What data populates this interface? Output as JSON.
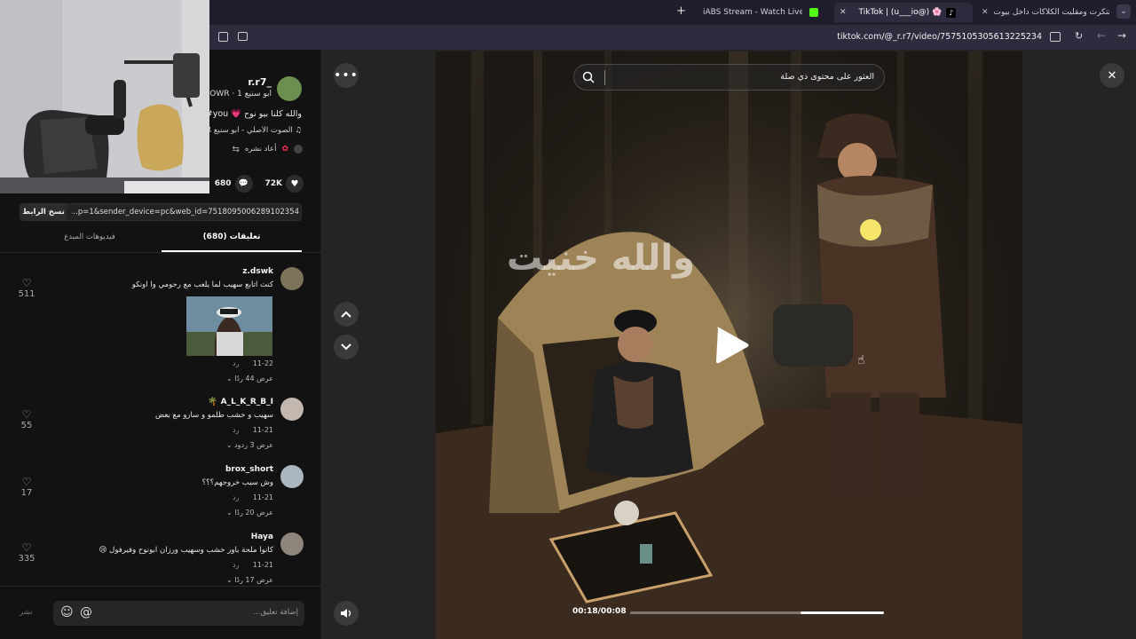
{
  "browser": {
    "tabs": [
      {
        "title": "تتكرت ومقلبت الكلاكات داخل بيوت",
        "active": false
      },
      {
        "title": "TikTok | (u___io@) 🌸",
        "active": true
      },
      {
        "title": "iABS Stream - Watch Live on Ki",
        "active": false
      }
    ],
    "new_tab": "+",
    "url": "tiktok.com/@_r.r7/video/7575105305613225234"
  },
  "post": {
    "username": "_r.r7",
    "subtitle": "أبو سنيع POWR · 1",
    "caption": "والله كلنا بيو نوح 💗 you#",
    "sound": "الصوت الأصلي - أبو سنيع R",
    "repost_label": "أعاد نشره",
    "likes": "72K",
    "comments": "680",
    "link": "p=1&sender_device=pc&web_id=7518095006289102354...",
    "copy_link": "نسخ الرابط"
  },
  "tabs": {
    "comments": "(680) تعليقات",
    "creator_videos": "فيديوهات المبدع"
  },
  "comments": [
    {
      "user": "z.dswk",
      "text": "كنت اتابع سهيب لما يلعب مع رحومي وا اونكو",
      "date": "11-22",
      "reply": "رد",
      "replies": "عرض 44 ردًا",
      "likes": "511",
      "has_image": true
    },
    {
      "user": "A_L_K_R_B_I 🌴",
      "text": "سهيب و خشب طلمو و سارو مع بعض",
      "date": "11-21",
      "reply": "رد",
      "replies": "عرض 3 ردود",
      "likes": "55",
      "has_image": false
    },
    {
      "user": "brox_short",
      "text": "وش سبب خروجهم؟؟؟",
      "date": "11-21",
      "reply": "رد",
      "replies": "عرض 20 ردًا",
      "likes": "17",
      "has_image": false
    },
    {
      "user": "Haya",
      "text": "كانوا ملحة باور خشب وسهيب ورزان ابونوح وفيرفول 😢",
      "date": "11-21",
      "reply": "رد",
      "replies": "عرض 17 ردًا",
      "likes": "335",
      "has_image": false
    }
  ],
  "comment_input": {
    "placeholder": "إضافة تعليق...",
    "post_label": "نشر"
  },
  "video": {
    "search_placeholder": "العثور على محتوى ذي صلة",
    "overlay_text": "والله خنيت",
    "time": "00:18/00:08",
    "progress": 0.33
  },
  "colors": {
    "accent": "#fe2c55",
    "link_blue": "#8fb4ff",
    "panel_bg": "#121212",
    "chrome_bg": "#1f1e2c"
  }
}
